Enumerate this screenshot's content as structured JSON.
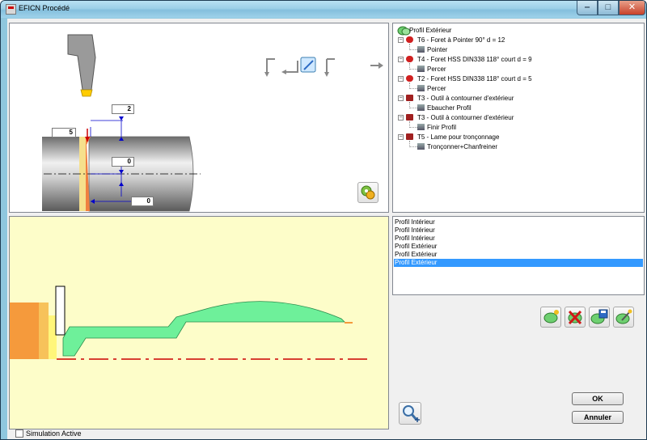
{
  "window": {
    "title": "EFICN Procédé",
    "min_glyph": "‒",
    "max_glyph": "□",
    "close_glyph": "✕"
  },
  "tool_panel": {
    "dimensions": {
      "top": "2",
      "left": "5",
      "middle": "0",
      "bottom": "0"
    }
  },
  "tree": {
    "root": "Profil Extérieur",
    "items": [
      {
        "label": "T6 - Foret à Pointer 90° d = 12",
        "child": "Pointer"
      },
      {
        "label": "T4 - Foret HSS DIN338 118° court d = 9",
        "child": "Percer"
      },
      {
        "label": "T2 - Foret HSS DIN338 118° court d = 5",
        "child": "Percer"
      },
      {
        "label": "T3 - Outil à contourner d'extérieur",
        "child": "Ebaucher Profil"
      },
      {
        "label": "T3 - Outil à contourner d'extérieur",
        "child": "Finir Profil"
      },
      {
        "label": "T5 - Lame pour tronçonnage",
        "child": "Tronçonner+Chanfreiner"
      }
    ]
  },
  "profile_list": {
    "items": [
      "Profil Intérieur",
      "Profil Intérieur",
      "Profil Intérieur",
      "Profil Extérieur",
      "Profil Extérieur",
      "Profil Extérieur"
    ],
    "selected_index": 5
  },
  "buttons": {
    "ok": "OK",
    "cancel": "Annuler"
  },
  "simulation": {
    "label": "Simulation Active",
    "checked": false
  },
  "colors": {
    "part": "#6ef09a",
    "stock": "#f59a3c",
    "centerline": "#cc0000",
    "sim_bg": "#fdfdc9"
  }
}
